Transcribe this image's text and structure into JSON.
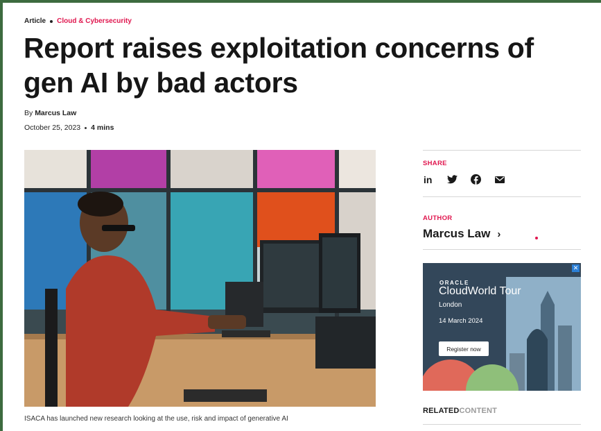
{
  "breadcrumb": {
    "type": "Article",
    "category": "Cloud & Cybersecurity"
  },
  "article": {
    "title": "Report raises exploitation concerns of gen AI by bad actors",
    "byline_prefix": "By",
    "author": "Marcus Law",
    "date": "October 25, 2023",
    "read_time": "4 mins",
    "caption": "ISACA has launched new research looking at the use, risk and impact of generative AI"
  },
  "sidebar": {
    "share_label": "SHARE",
    "share_icons": [
      "linkedin-icon",
      "twitter-icon",
      "facebook-icon",
      "email-icon"
    ],
    "author_label": "AUTHOR",
    "author_name": "Marcus Law",
    "author_chevron": "›"
  },
  "ad": {
    "brand": "ORACLE",
    "headline": "CloudWorld Tour",
    "city": "London",
    "date": "14 March 2024",
    "cta": "Register now",
    "close": "✕"
  },
  "related": {
    "part1": "RELATED",
    "part2": "CONTENT"
  },
  "colors": {
    "accent": "#e0174f",
    "frame": "#3d6b3f"
  }
}
